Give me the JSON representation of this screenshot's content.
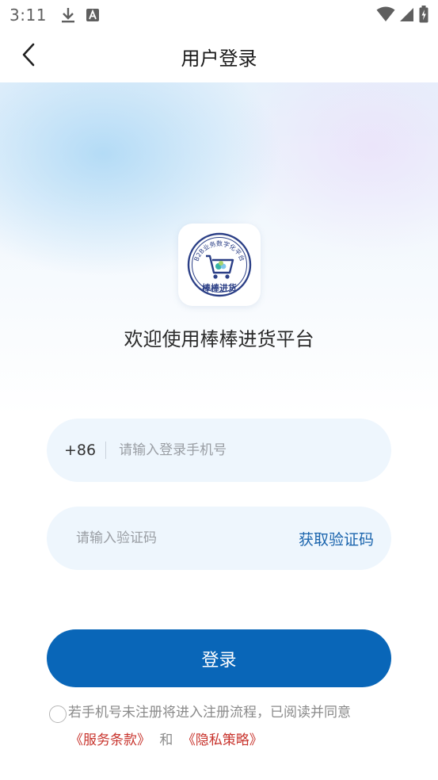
{
  "status_bar": {
    "time": "3:11",
    "icons": [
      "download-icon",
      "text-a-icon",
      "wifi-icon",
      "signal-icon",
      "battery-charging-icon"
    ]
  },
  "header": {
    "title": "用户登录",
    "back_icon": "chevron-left-icon"
  },
  "logo": {
    "ring_text": "B2B业务数字化平台",
    "brand_text": "棒棒进货"
  },
  "welcome": "欢迎使用棒棒进货平台",
  "form": {
    "country_code": "+86",
    "phone_placeholder": "请输入登录手机号",
    "phone_value": "",
    "code_placeholder": "请输入验证码",
    "code_value": "",
    "get_code_label": "获取验证码",
    "submit_label": "登录"
  },
  "agreement": {
    "checked": false,
    "text": "若手机号未注册将进入注册流程，已阅读并同意",
    "terms_link": "《服务条款》",
    "joiner": "和",
    "privacy_link": "《隐私策略》"
  },
  "colors": {
    "primary": "#0966b8",
    "link_blue": "#1a64ad",
    "link_red": "#c8342d",
    "field_bg": "#eef6fd"
  }
}
